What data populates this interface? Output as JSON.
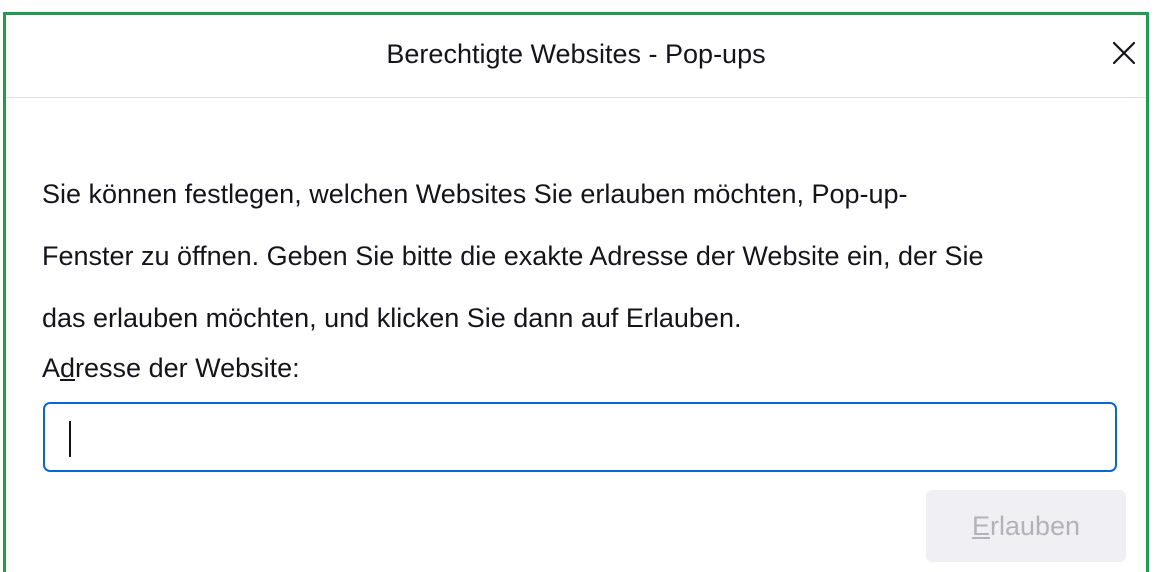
{
  "dialog": {
    "title": "Berechtigte Websites - Pop-ups",
    "close_icon": "close-icon",
    "description_lines": [
      "Sie können festlegen, welchen Websites Sie erlauben möchten, Pop-up-",
      "Fenster zu öffnen. Geben Sie bitte die exakte Adresse der Website ein, der Sie",
      "das erlauben möchten, und klicken Sie dann auf Erlauben."
    ],
    "address_label_prefix": "A",
    "address_label_accesskey": "d",
    "address_label_rest": "resse der Website:",
    "address_value": "",
    "allow_button_accesskey": "E",
    "allow_button_rest": "rlauben",
    "allow_button_disabled": true
  },
  "colors": {
    "frame_accent": "#1e9d4f",
    "focus_ring": "#0a66d8",
    "disabled_button_bg": "#f0f0f4",
    "disabled_button_text": "#b2b2b8"
  }
}
